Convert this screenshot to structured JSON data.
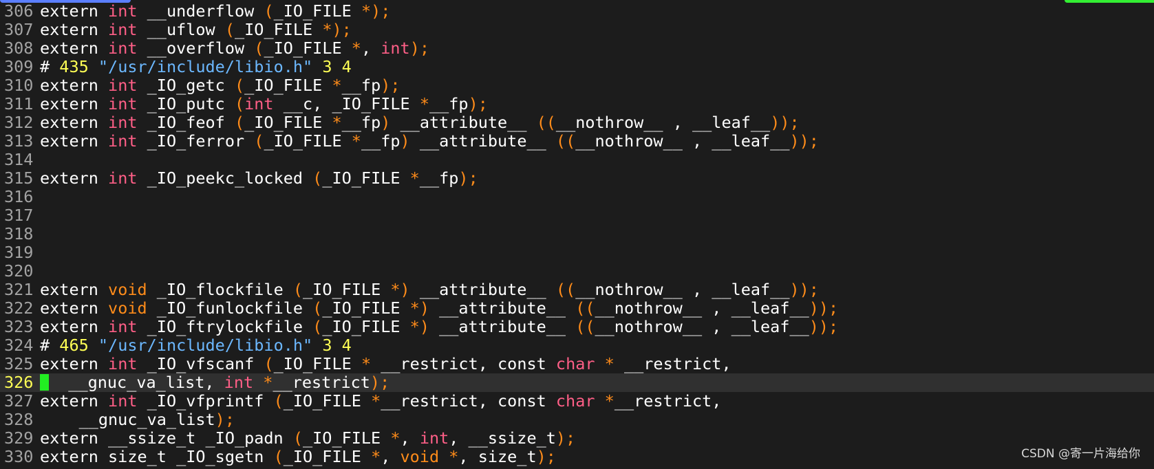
{
  "colors": {
    "background": "#1c1c1c",
    "line_number": "#a3a3a3",
    "current_line_number": "#ffff55",
    "plain": "#ffffff",
    "type_keyword": "#ff5f87",
    "punctuation": "#ff8c1a",
    "string": "#6cb8ff",
    "number": "#ffff55",
    "cursor": "#22ee22",
    "current_line_bg": "#303030"
  },
  "watermark": "CSDN @寄一片海给你",
  "lines": [
    {
      "num": "306",
      "tokens": [
        [
          "plain",
          "extern "
        ],
        [
          "type",
          "int"
        ],
        [
          "plain",
          " __underflow "
        ],
        [
          "punct",
          "("
        ],
        [
          "plain",
          "_IO_FILE "
        ],
        [
          "punct",
          "*);"
        ]
      ]
    },
    {
      "num": "307",
      "tokens": [
        [
          "plain",
          "extern "
        ],
        [
          "type",
          "int"
        ],
        [
          "plain",
          " __uflow "
        ],
        [
          "punct",
          "("
        ],
        [
          "plain",
          "_IO_FILE "
        ],
        [
          "punct",
          "*);"
        ]
      ]
    },
    {
      "num": "308",
      "tokens": [
        [
          "plain",
          "extern "
        ],
        [
          "type",
          "int"
        ],
        [
          "plain",
          " __overflow "
        ],
        [
          "punct",
          "("
        ],
        [
          "plain",
          "_IO_FILE "
        ],
        [
          "punct",
          "*"
        ],
        [
          "plain",
          ", "
        ],
        [
          "type",
          "int"
        ],
        [
          "punct",
          ");"
        ]
      ]
    },
    {
      "num": "309",
      "tokens": [
        [
          "plain",
          "# "
        ],
        [
          "number",
          "435"
        ],
        [
          "plain",
          " "
        ],
        [
          "string",
          "\"/usr/include/libio.h\""
        ],
        [
          "plain",
          " "
        ],
        [
          "number",
          "3"
        ],
        [
          "plain",
          " "
        ],
        [
          "number",
          "4"
        ]
      ]
    },
    {
      "num": "310",
      "tokens": [
        [
          "plain",
          "extern "
        ],
        [
          "type",
          "int"
        ],
        [
          "plain",
          " _IO_getc "
        ],
        [
          "punct",
          "("
        ],
        [
          "plain",
          "_IO_FILE "
        ],
        [
          "punct",
          "*"
        ],
        [
          "plain",
          "__fp"
        ],
        [
          "punct",
          ");"
        ]
      ]
    },
    {
      "num": "311",
      "tokens": [
        [
          "plain",
          "extern "
        ],
        [
          "type",
          "int"
        ],
        [
          "plain",
          " _IO_putc "
        ],
        [
          "punct",
          "("
        ],
        [
          "type",
          "int"
        ],
        [
          "plain",
          " __c, _IO_FILE "
        ],
        [
          "punct",
          "*"
        ],
        [
          "plain",
          "__fp"
        ],
        [
          "punct",
          ");"
        ]
      ]
    },
    {
      "num": "312",
      "tokens": [
        [
          "plain",
          "extern "
        ],
        [
          "type",
          "int"
        ],
        [
          "plain",
          " _IO_feof "
        ],
        [
          "punct",
          "("
        ],
        [
          "plain",
          "_IO_FILE "
        ],
        [
          "punct",
          "*"
        ],
        [
          "plain",
          "__fp"
        ],
        [
          "punct",
          ")"
        ],
        [
          "plain",
          " __attribute__ "
        ],
        [
          "punct",
          "(("
        ],
        [
          "plain",
          "__nothrow__ , __leaf__"
        ],
        [
          "punct",
          "));"
        ]
      ]
    },
    {
      "num": "313",
      "tokens": [
        [
          "plain",
          "extern "
        ],
        [
          "type",
          "int"
        ],
        [
          "plain",
          " _IO_ferror "
        ],
        [
          "punct",
          "("
        ],
        [
          "plain",
          "_IO_FILE "
        ],
        [
          "punct",
          "*"
        ],
        [
          "plain",
          "__fp"
        ],
        [
          "punct",
          ")"
        ],
        [
          "plain",
          " __attribute__ "
        ],
        [
          "punct",
          "(("
        ],
        [
          "plain",
          "__nothrow__ , __leaf__"
        ],
        [
          "punct",
          "));"
        ]
      ]
    },
    {
      "num": "314",
      "tokens": []
    },
    {
      "num": "315",
      "tokens": [
        [
          "plain",
          "extern "
        ],
        [
          "type",
          "int"
        ],
        [
          "plain",
          " _IO_peekc_locked "
        ],
        [
          "punct",
          "("
        ],
        [
          "plain",
          "_IO_FILE "
        ],
        [
          "punct",
          "*"
        ],
        [
          "plain",
          "__fp"
        ],
        [
          "punct",
          ");"
        ]
      ]
    },
    {
      "num": "316",
      "tokens": []
    },
    {
      "num": "317",
      "tokens": []
    },
    {
      "num": "318",
      "tokens": []
    },
    {
      "num": "319",
      "tokens": []
    },
    {
      "num": "320",
      "tokens": []
    },
    {
      "num": "321",
      "tokens": [
        [
          "plain",
          "extern "
        ],
        [
          "punct",
          "void"
        ],
        [
          "plain",
          " _IO_flockfile "
        ],
        [
          "punct",
          "("
        ],
        [
          "plain",
          "_IO_FILE "
        ],
        [
          "punct",
          "*)"
        ],
        [
          "plain",
          " __attribute__ "
        ],
        [
          "punct",
          "(("
        ],
        [
          "plain",
          "__nothrow__ , __leaf__"
        ],
        [
          "punct",
          "));"
        ]
      ]
    },
    {
      "num": "322",
      "tokens": [
        [
          "plain",
          "extern "
        ],
        [
          "punct",
          "void"
        ],
        [
          "plain",
          " _IO_funlockfile "
        ],
        [
          "punct",
          "("
        ],
        [
          "plain",
          "_IO_FILE "
        ],
        [
          "punct",
          "*)"
        ],
        [
          "plain",
          " __attribute__ "
        ],
        [
          "punct",
          "(("
        ],
        [
          "plain",
          "__nothrow__ , __leaf__"
        ],
        [
          "punct",
          "));"
        ]
      ]
    },
    {
      "num": "323",
      "tokens": [
        [
          "plain",
          "extern "
        ],
        [
          "type",
          "int"
        ],
        [
          "plain",
          " _IO_ftrylockfile "
        ],
        [
          "punct",
          "("
        ],
        [
          "plain",
          "_IO_FILE "
        ],
        [
          "punct",
          "*)"
        ],
        [
          "plain",
          " __attribute__ "
        ],
        [
          "punct",
          "(("
        ],
        [
          "plain",
          "__nothrow__ , __leaf__"
        ],
        [
          "punct",
          "));"
        ]
      ]
    },
    {
      "num": "324",
      "tokens": [
        [
          "plain",
          "# "
        ],
        [
          "number",
          "465"
        ],
        [
          "plain",
          " "
        ],
        [
          "string",
          "\"/usr/include/libio.h\""
        ],
        [
          "plain",
          " "
        ],
        [
          "number",
          "3"
        ],
        [
          "plain",
          " "
        ],
        [
          "number",
          "4"
        ]
      ]
    },
    {
      "num": "325",
      "tokens": [
        [
          "plain",
          "extern "
        ],
        [
          "type",
          "int"
        ],
        [
          "plain",
          " _IO_vfscanf "
        ],
        [
          "punct",
          "("
        ],
        [
          "plain",
          "_IO_FILE "
        ],
        [
          "punct",
          "*"
        ],
        [
          "plain",
          " __restrict, const "
        ],
        [
          "type",
          "char"
        ],
        [
          "plain",
          " "
        ],
        [
          "punct",
          "*"
        ],
        [
          "plain",
          " __restrict,"
        ]
      ]
    },
    {
      "num": "326",
      "current": true,
      "tokens": [
        [
          "cursor",
          ""
        ],
        [
          "plain",
          "  __gnuc_va_list, "
        ],
        [
          "type",
          "int"
        ],
        [
          "plain",
          " "
        ],
        [
          "punct",
          "*"
        ],
        [
          "plain",
          "__restrict"
        ],
        [
          "punct",
          ");"
        ]
      ]
    },
    {
      "num": "327",
      "tokens": [
        [
          "plain",
          "extern "
        ],
        [
          "type",
          "int"
        ],
        [
          "plain",
          " _IO_vfprintf "
        ],
        [
          "punct",
          "("
        ],
        [
          "plain",
          "_IO_FILE "
        ],
        [
          "punct",
          "*"
        ],
        [
          "plain",
          "__restrict, const "
        ],
        [
          "type",
          "char"
        ],
        [
          "plain",
          " "
        ],
        [
          "punct",
          "*"
        ],
        [
          "plain",
          "__restrict,"
        ]
      ]
    },
    {
      "num": "328",
      "tokens": [
        [
          "plain",
          "    __gnuc_va_list"
        ],
        [
          "punct",
          ");"
        ]
      ]
    },
    {
      "num": "329",
      "tokens": [
        [
          "plain",
          "extern __ssize_t _IO_padn "
        ],
        [
          "punct",
          "("
        ],
        [
          "plain",
          "_IO_FILE "
        ],
        [
          "punct",
          "*"
        ],
        [
          "plain",
          ", "
        ],
        [
          "type",
          "int"
        ],
        [
          "plain",
          ", __ssize_t"
        ],
        [
          "punct",
          ");"
        ]
      ]
    },
    {
      "num": "330",
      "tokens": [
        [
          "plain",
          "extern size_t _IO_sgetn "
        ],
        [
          "punct",
          "("
        ],
        [
          "plain",
          "_IO_FILE "
        ],
        [
          "punct",
          "*"
        ],
        [
          "plain",
          ", "
        ],
        [
          "punct",
          "void"
        ],
        [
          "plain",
          " "
        ],
        [
          "punct",
          "*"
        ],
        [
          "plain",
          ", size_t"
        ],
        [
          "punct",
          ");"
        ]
      ]
    }
  ]
}
